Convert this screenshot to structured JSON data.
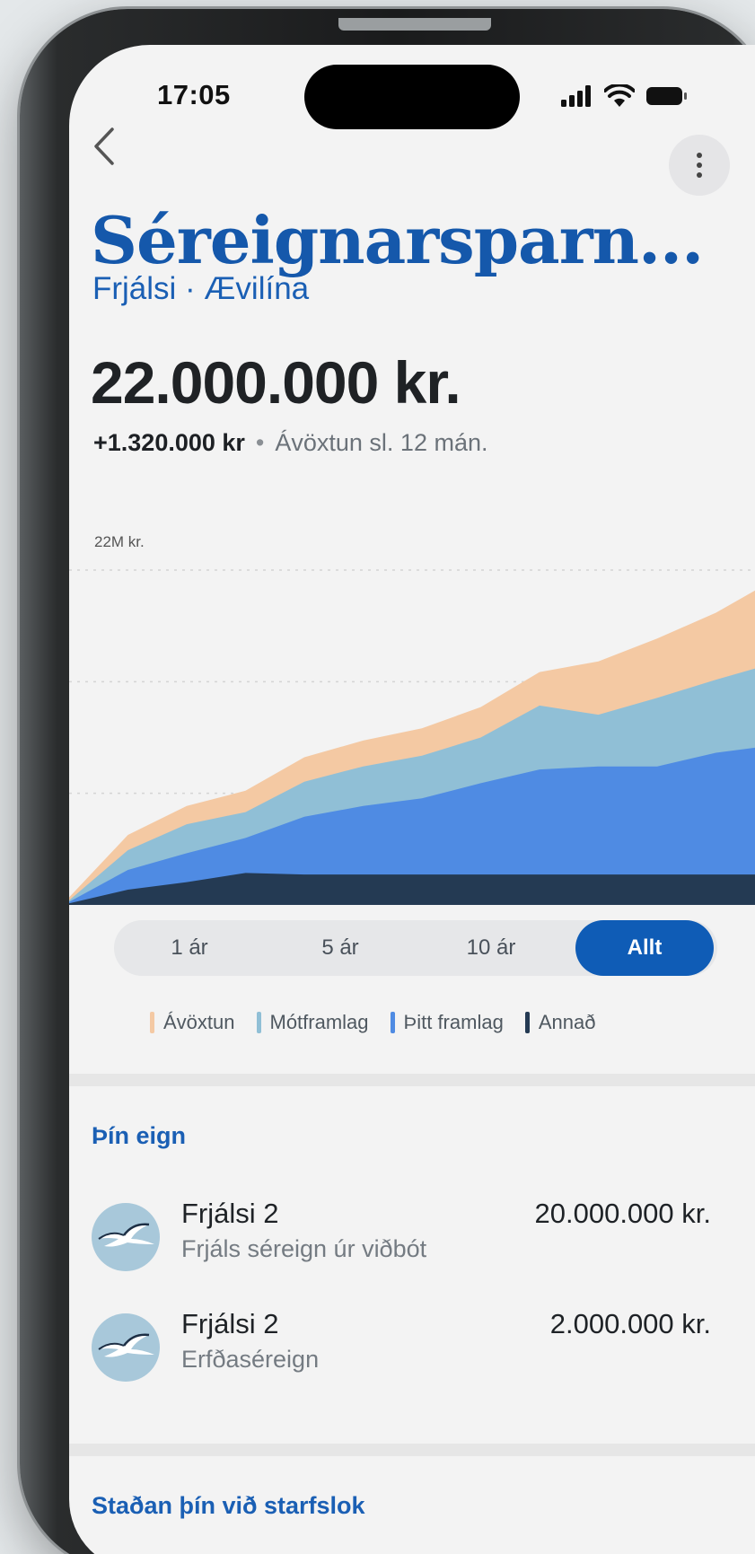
{
  "status_bar": {
    "time": "17:05"
  },
  "header": {
    "title": "Séreignarsparn...",
    "subtitle": "Frjálsi · Ævilína"
  },
  "summary": {
    "amount": "22.000.000 kr.",
    "change": "+1.320.000 kr",
    "separator": "•",
    "change_label": "Ávöxtun sl. 12 mán."
  },
  "chart_data": {
    "type": "area",
    "stacked": true,
    "y_tick_labels": [
      "22M kr."
    ],
    "ylim": [
      0,
      22
    ],
    "grid": true,
    "x": [
      0,
      1,
      2,
      3,
      4,
      5,
      6,
      7,
      8,
      9,
      10,
      11,
      12
    ],
    "series": [
      {
        "name": "Annað",
        "color": "#243a53",
        "values": [
          0.1,
          1.0,
          1.5,
          2.1,
          2.0,
          2.0,
          2.0,
          2.0,
          2.0,
          2.0,
          2.0,
          2.0,
          2.0
        ]
      },
      {
        "name": "Þitt framlag",
        "color": "#4f8be3",
        "values": [
          0.1,
          1.3,
          1.9,
          2.3,
          3.8,
          4.5,
          5.0,
          6.0,
          6.9,
          7.1,
          7.1,
          8.0,
          8.5
        ]
      },
      {
        "name": "Mótframlag",
        "color": "#90bfd6",
        "values": [
          0.1,
          1.3,
          1.9,
          1.7,
          2.3,
          2.6,
          2.8,
          3.0,
          4.2,
          3.4,
          4.5,
          4.8,
          5.4
        ]
      },
      {
        "name": "Ávöxtun",
        "color": "#f4c9a3",
        "values": [
          0.2,
          1.0,
          1.2,
          1.4,
          1.6,
          1.7,
          1.8,
          2.0,
          2.2,
          3.5,
          3.9,
          4.4,
          5.5
        ]
      }
    ]
  },
  "range_selector": {
    "options": [
      "1 ár",
      "5 ár",
      "10 ár",
      "Allt"
    ],
    "selected": "Allt"
  },
  "legend": [
    {
      "label": "Ávöxtun",
      "color": "#f4c9a3"
    },
    {
      "label": "Mótframlag",
      "color": "#90bfd6"
    },
    {
      "label": "Þitt framlag",
      "color": "#4f8be3"
    },
    {
      "label": "Annað",
      "color": "#243a53"
    }
  ],
  "holdings": {
    "title": "Þín eign",
    "items": [
      {
        "name": "Frjálsi 2",
        "description": "Frjáls séreign úr viðbót",
        "value": "20.000.000 kr."
      },
      {
        "name": "Frjálsi 2",
        "description": "Erfðaséreign",
        "value": "2.000.000 kr."
      }
    ]
  },
  "retirement": {
    "title": "Staðan þín við starfslok"
  },
  "icons": [
    "back-chevron-icon",
    "more-vertical-icon",
    "signal-icon",
    "wifi-icon",
    "battery-icon",
    "seagull-logo-icon"
  ],
  "colors": {
    "primary": "#1558ab",
    "accent": "#0f5cb6",
    "background": "#f3f3f3"
  }
}
